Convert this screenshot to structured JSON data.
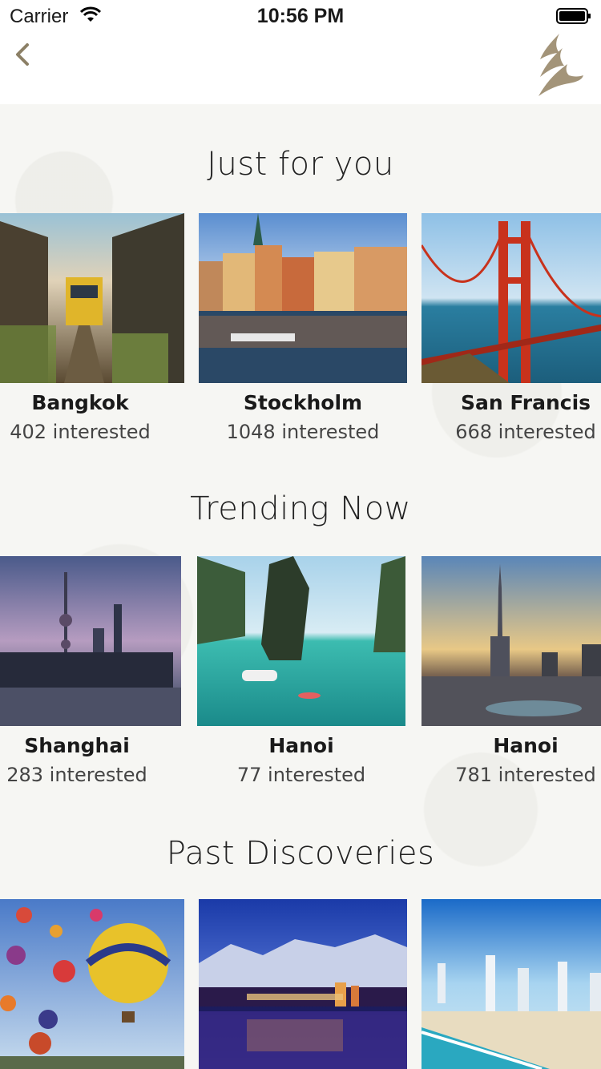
{
  "status_bar": {
    "carrier": "Carrier",
    "time": "10:56 PM"
  },
  "nav": {
    "back_icon": "chevron-left-icon",
    "logo": "singapore-airlines-bird-logo"
  },
  "sections": [
    {
      "title": "Just for you",
      "cards": [
        {
          "name": "Bangkok",
          "count": "402 interested"
        },
        {
          "name": "Stockholm",
          "count": "1048 interested"
        },
        {
          "name": "San Francis",
          "count": "668 interested"
        }
      ]
    },
    {
      "title": "Trending Now",
      "cards": [
        {
          "name": "Shanghai",
          "count": "283 interested"
        },
        {
          "name": "Hanoi",
          "count": "77 interested"
        },
        {
          "name": "Hanoi",
          "count": "781 interested"
        }
      ]
    },
    {
      "title": "Past Discoveries",
      "cards": [
        {
          "name": "",
          "count": ""
        },
        {
          "name": "",
          "count": ""
        },
        {
          "name": "",
          "count": ""
        }
      ]
    }
  ],
  "colors": {
    "accent": "#a39479",
    "background": "#f6f6f3"
  }
}
